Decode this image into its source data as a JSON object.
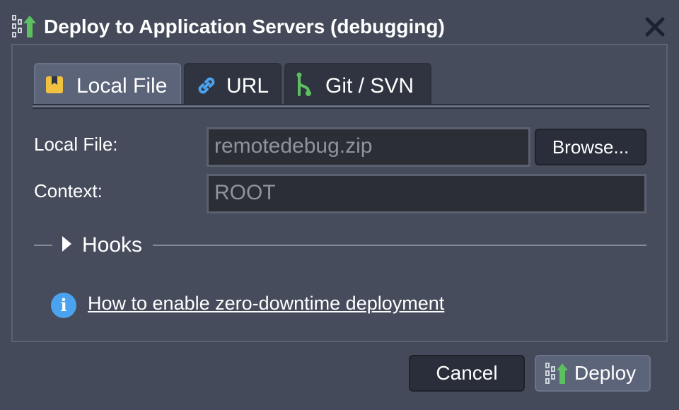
{
  "dialog": {
    "title": "Deploy to Application Servers (debugging)",
    "title_icon": "deploy-upload-icon",
    "close_icon": "close-icon"
  },
  "tabs": [
    {
      "label": "Local File",
      "icon": "archive-file-icon",
      "active": true,
      "icon_color": "#f0c040"
    },
    {
      "label": "URL",
      "icon": "link-icon",
      "active": false,
      "icon_color": "#4ba3f0"
    },
    {
      "label": "Git / SVN",
      "icon": "git-branch-icon",
      "active": false,
      "icon_color": "#5cc060"
    }
  ],
  "form": {
    "local_file_label": "Local File:",
    "local_file_value": "remotedebug.zip",
    "browse_label": "Browse...",
    "context_label": "Context:",
    "context_value": "ROOT"
  },
  "hooks": {
    "label": "Hooks",
    "expanded": false
  },
  "info": {
    "link_text": "How to enable zero-downtime deployment",
    "icon": "info-icon"
  },
  "footer": {
    "cancel_label": "Cancel",
    "deploy_label": "Deploy"
  },
  "colors": {
    "dialog_bg": "#444a59",
    "accent_green": "#5cc060",
    "info_blue": "#4ba3f0"
  }
}
